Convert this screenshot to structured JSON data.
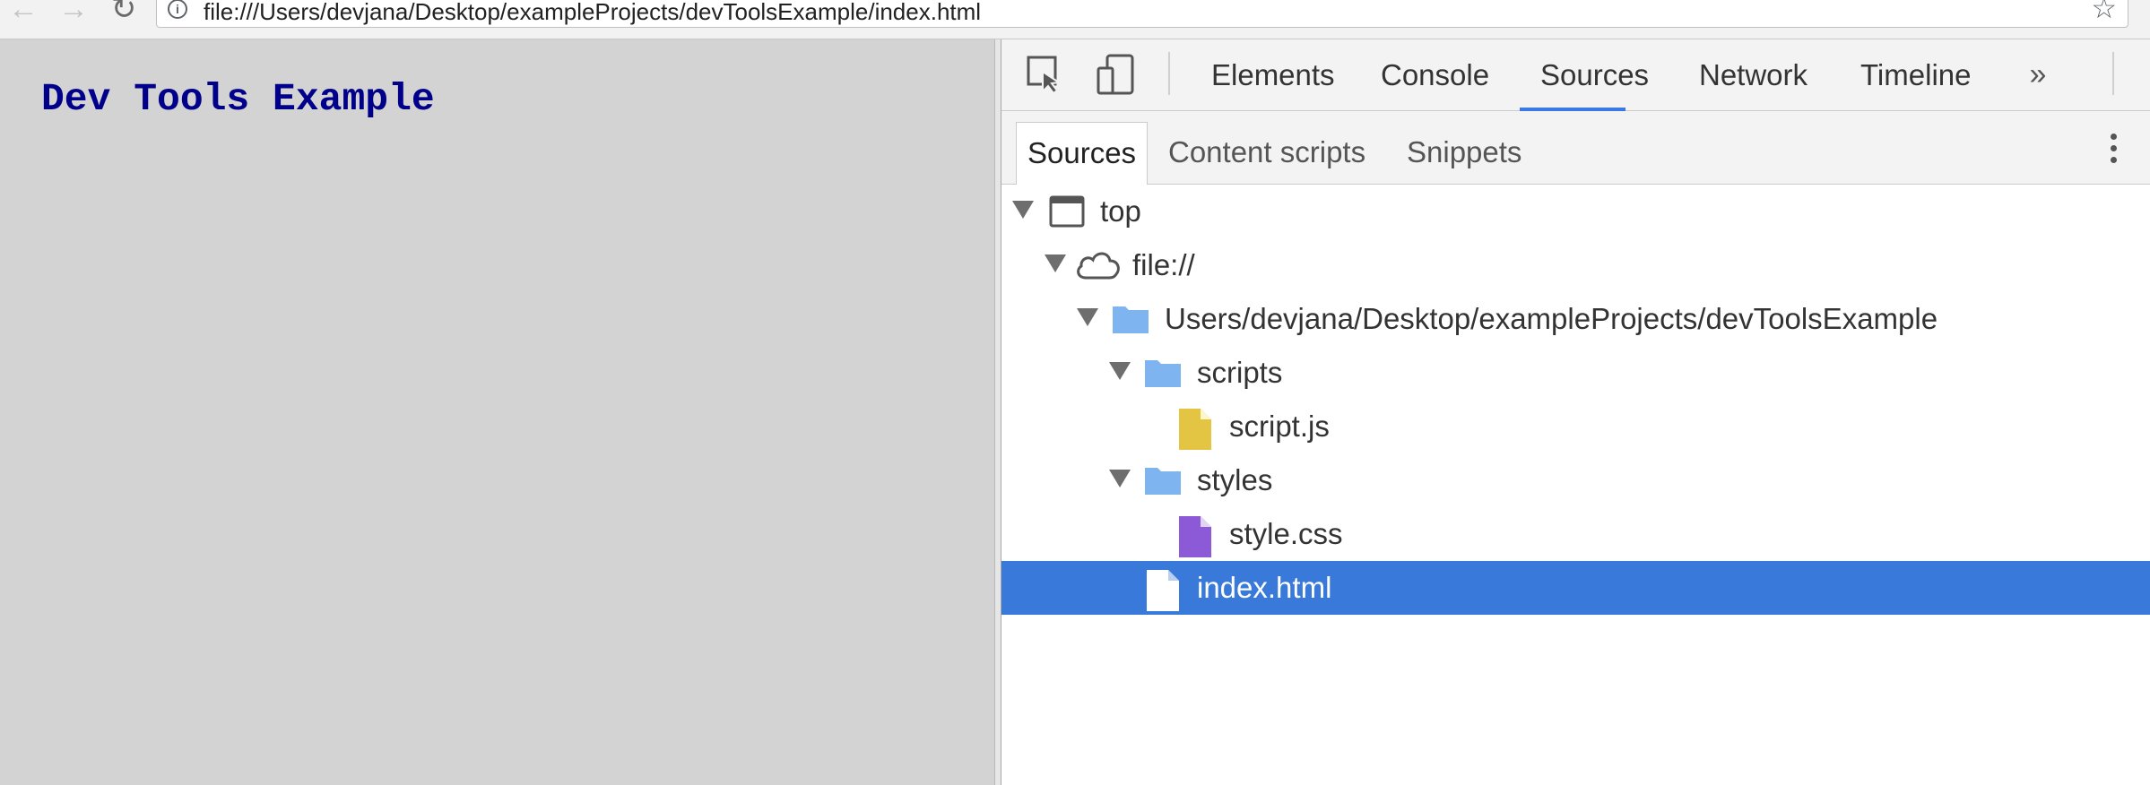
{
  "browser": {
    "url": "file:///Users/devjana/Desktop/exampleProjects/devToolsExample/index.html"
  },
  "page": {
    "heading": "Dev Tools Example",
    "background_color": "#d3d3d3",
    "heading_color": "#00008b"
  },
  "devtools": {
    "tabs": [
      {
        "label": "Elements",
        "active": false
      },
      {
        "label": "Console",
        "active": false
      },
      {
        "label": "Sources",
        "active": true
      },
      {
        "label": "Network",
        "active": false
      },
      {
        "label": "Timeline",
        "active": false
      }
    ],
    "overflow_icon": "double-chevron-right-icon",
    "accent_color": "#3b78e7",
    "sub_tabs": [
      {
        "label": "Sources",
        "active": true
      },
      {
        "label": "Content scripts",
        "active": false
      },
      {
        "label": "Snippets",
        "active": false
      }
    ],
    "tree": [
      {
        "label": "top",
        "icon": "frame-icon",
        "expanded": true,
        "selected": false
      },
      {
        "label": "file://",
        "icon": "cloud-icon",
        "expanded": true,
        "selected": false
      },
      {
        "label": "Users/devjana/Desktop/exampleProjects/devToolsExample",
        "icon": "folder-icon",
        "expanded": true,
        "selected": false
      },
      {
        "label": "scripts",
        "icon": "folder-icon",
        "expanded": true,
        "selected": false
      },
      {
        "label": "script.js",
        "icon": "js-file-icon",
        "selected": false
      },
      {
        "label": "styles",
        "icon": "folder-icon",
        "expanded": true,
        "selected": false
      },
      {
        "label": "style.css",
        "icon": "css-file-icon",
        "selected": false
      },
      {
        "label": "index.html",
        "icon": "html-file-icon",
        "selected": true
      }
    ],
    "selection_color": "#3879d9"
  }
}
